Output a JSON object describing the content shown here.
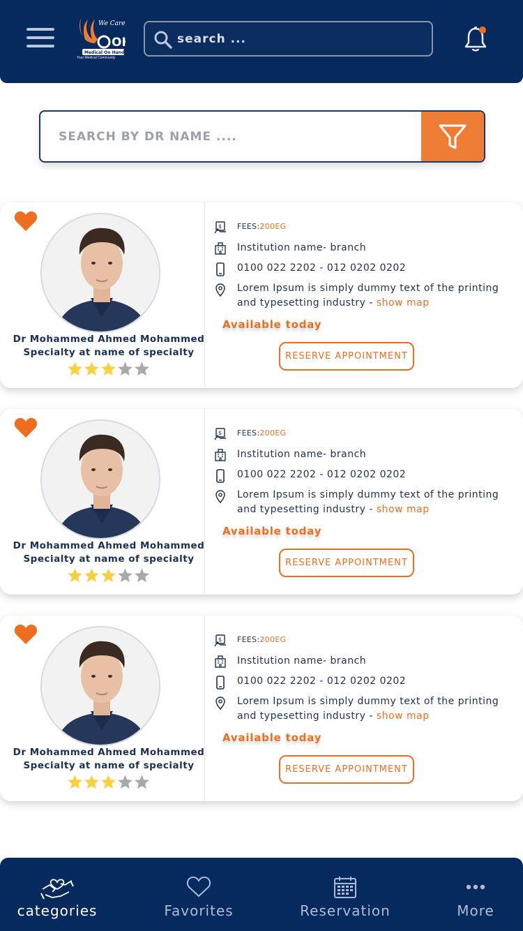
{
  "header": {
    "logo_text": "OH",
    "logo_tag": "We Care",
    "logo_sub": "Medical On Hand",
    "logo_tagline": "Your Medical Community",
    "search_placeholder": "search ...",
    "notification_dot_color": "#ef6d1e"
  },
  "doctor_search": {
    "placeholder": "SEARCH BY DR NAME ....",
    "filter_icon": "filter-icon"
  },
  "doctors": [
    {
      "name": "Dr Mohammed Ahmed Mohammed",
      "specialty": "Specialty at name of specialty",
      "rating": 3,
      "rating_max": 5,
      "fees_label": "FEES:",
      "fees_value": "200EG",
      "institution": "Institution name- branch",
      "phone": "0100 022 2202 - 012 0202 0202",
      "address": "Lorem Ipsum is simply dummy text of the printing and typesetting industry - ",
      "map_link": "show map",
      "availability": "Available today",
      "reserve_label": "RESERVE APPOINTMENT"
    },
    {
      "name": "Dr Mohammed Ahmed Mohammed",
      "specialty": "Specialty at name of specialty",
      "rating": 3,
      "rating_max": 5,
      "fees_label": "FEES:",
      "fees_value": "200EG",
      "institution": "Institution name- branch",
      "phone": "0100 022 2202 - 012 0202 0202",
      "address": "Lorem Ipsum is simply dummy text of the printing and typesetting industry - ",
      "map_link": "show map",
      "availability": "Available today",
      "reserve_label": "RESERVE APPOINTMENT"
    },
    {
      "name": "Dr Mohammed Ahmed Mohammed",
      "specialty": "Specialty at name of specialty",
      "rating": 3,
      "rating_max": 5,
      "fees_label": "FEES:",
      "fees_value": "200EG",
      "institution": "Institution name- branch",
      "phone": "0100 022 2202 - 012 0202 0202",
      "address": "Lorem Ipsum is simply dummy text of the printing and typesetting industry - ",
      "map_link": "show map",
      "availability": "Available today",
      "reserve_label": "RESERVE APPOINTMENT"
    }
  ],
  "bottom_nav": {
    "items": [
      {
        "label": "categories",
        "icon": "care-hands-icon",
        "active": true
      },
      {
        "label": "Favorites",
        "icon": "heart-outline-icon",
        "active": false
      },
      {
        "label": "Reservation",
        "icon": "calendar-icon",
        "active": false
      },
      {
        "label": "More",
        "icon": "more-dots-icon",
        "active": false
      }
    ]
  },
  "colors": {
    "navy": "#062a5e",
    "accent": "#ef7c34",
    "star_filled": "#f7cf3f",
    "star_empty": "#a7a9ad"
  }
}
